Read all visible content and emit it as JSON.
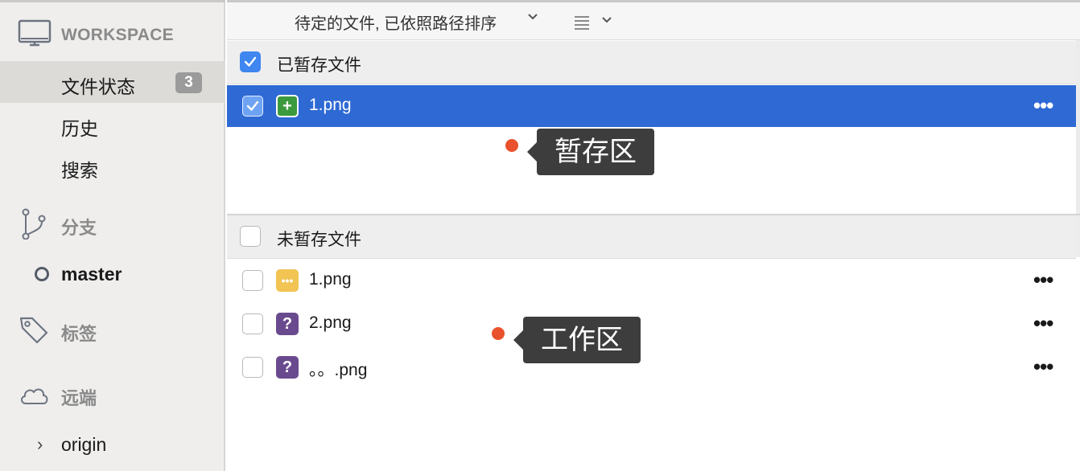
{
  "sidebar": {
    "workspace_label": "WORKSPACE",
    "items": [
      {
        "label": "文件状态",
        "badge": "3"
      },
      {
        "label": "历史"
      },
      {
        "label": "搜索"
      }
    ],
    "branches": {
      "label": "分支",
      "current": "master"
    },
    "tags": {
      "label": "标签"
    },
    "remotes": {
      "label": "远端",
      "items": [
        "origin"
      ]
    }
  },
  "toolbar": {
    "sort_label": "待定的文件, 已依照路径排序"
  },
  "staged": {
    "title": "已暂存文件",
    "files": [
      {
        "name": "1.png",
        "status": "added",
        "checked": true
      }
    ]
  },
  "unstaged": {
    "title": "未暂存文件",
    "files": [
      {
        "name": "1.png",
        "status": "modified"
      },
      {
        "name": "2.png",
        "status": "untracked"
      },
      {
        "name": "。。.png",
        "status": "untracked"
      }
    ]
  },
  "annotations": {
    "staging_area": "暂存区",
    "working_area": "工作区"
  },
  "colors": {
    "selection": "#2e69d4",
    "checkbox_checked": "#3f86f0",
    "added": "#3c9a3e",
    "modified": "#f1c453",
    "untracked": "#6a4a8f",
    "annotation_dot": "#e9522c"
  },
  "icons": {
    "workspace": "monitor-icon",
    "branches": "branch-icon",
    "tags": "tag-icon",
    "remotes": "cloud-icon",
    "more": "ellipsis-icon",
    "added": "plus-icon",
    "modified": "dots-icon",
    "untracked": "question-icon"
  }
}
